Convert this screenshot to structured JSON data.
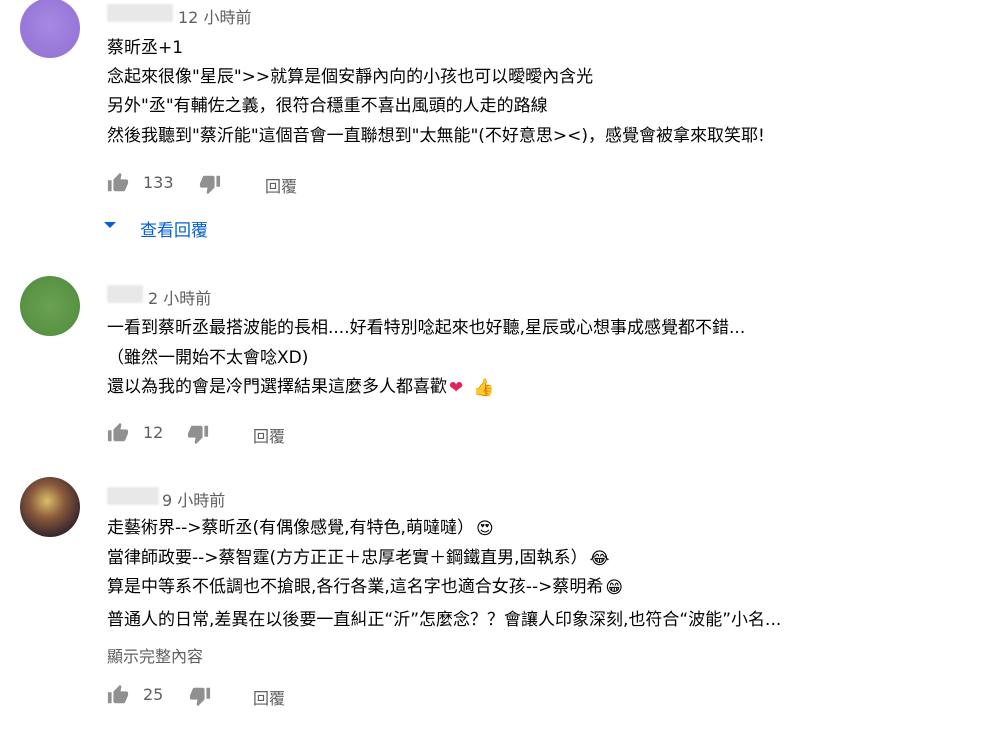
{
  "comments": [
    {
      "time": "12 小時前",
      "lines": [
        "蔡昕丞+1",
        "念起來很像\"星辰\">>就算是個安靜內向的小孩也可以曖曖內含光",
        "另外\"丞\"有輔佐之義，很符合穩重不喜出風頭的人走的路線",
        "然後我聽到\"蔡沂能\"這個音會一直聯想到\"太無能\"(不好意思><)，感覺會被拿來取笑耶!"
      ],
      "likes": "133",
      "reply_label": "回覆",
      "view_replies_label": "查看回覆"
    },
    {
      "time": "2 小時前",
      "lines": [
        "一看到蔡昕丞最搭波能的長相....好看特別唸起來也好聽,星辰或心想事成感覺都不錯...",
        "（雖然一開始不太會唸XD)",
        "還以為我的會是冷門選擇結果這麼多人都喜歡"
      ],
      "emoji": [
        "heart-sparkle-emoji",
        "thumbs-up-emoji"
      ],
      "likes": "12",
      "reply_label": "回覆"
    },
    {
      "time": "9 小時前",
      "lines": [
        "走藝術界-->蔡昕丞(有偶像感覺,有特色,萌噠噠）",
        "當律師政要-->蔡智霆(方方正正＋忠厚老實＋鋼鐵直男,固執系）",
        "算是中等系不低調也不搶眼,各行各業,這名字也適合女孩-->蔡明希",
        "普通人的日常,差異在以後要一直糾正“沂”怎麼念？？會讓人印象深刻,也符合“波能”小名..."
      ],
      "emoji": [
        "heart-eyes-emoji",
        "tears-of-joy-emoji",
        "grinning-emoji"
      ],
      "show_more": "顯示完整內容",
      "likes": "25",
      "reply_label": "回覆"
    }
  ],
  "colors": {
    "link": "#065fd4",
    "secondary_text": "#606060",
    "primary_text": "#030303",
    "icon": "#909090"
  }
}
